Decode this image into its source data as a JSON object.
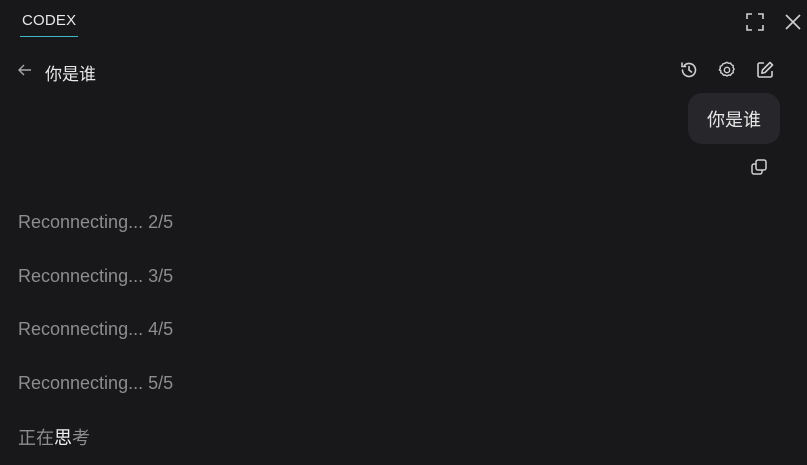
{
  "tab": {
    "label": "CODEX"
  },
  "window_controls": {
    "expand_icon": "expand-icon",
    "close_icon": "close-icon"
  },
  "header": {
    "back_icon": "arrow-left-icon",
    "title": "你是谁",
    "actions": [
      "history-icon",
      "gear-icon",
      "edit-icon"
    ]
  },
  "conversation": {
    "user_message": "你是谁",
    "copy_icon": "copy-icon",
    "status_lines": [
      "Reconnecting... 2/5",
      "Reconnecting... 3/5",
      "Reconnecting... 4/5",
      "Reconnecting... 5/5"
    ],
    "thinking": {
      "part1": "正在",
      "part2": "思",
      "part3": "考"
    }
  },
  "colors": {
    "background": "#18181b",
    "bubble": "#26262b",
    "accent": "#3fb8c8",
    "muted_text": "#8d8d8f"
  }
}
